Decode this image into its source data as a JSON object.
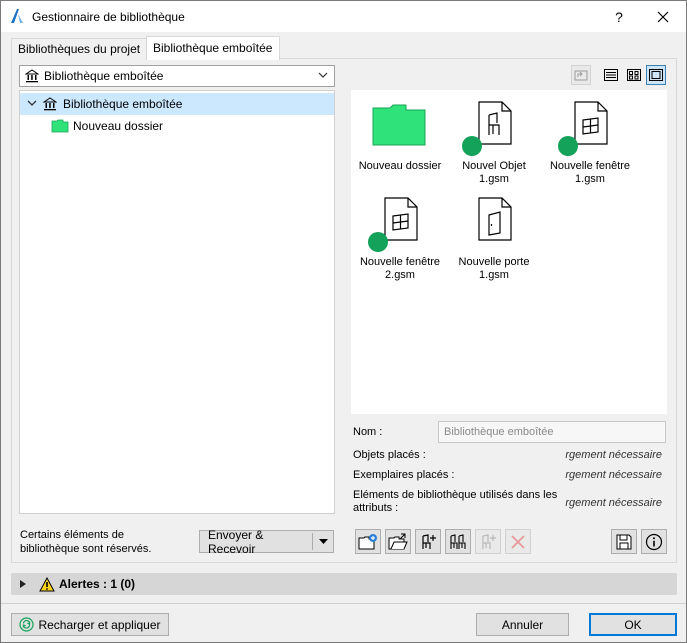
{
  "window": {
    "title": "Gestionnaire de bibliothèque",
    "help_label": "?",
    "close_label": "✕"
  },
  "tabs": [
    {
      "label": "Bibliothèques du projet"
    },
    {
      "label": "Bibliothèque emboîtée"
    }
  ],
  "library_select": {
    "value": "Bibliothèque emboîtée"
  },
  "tree": {
    "root": "Bibliothèque emboîtée",
    "children": [
      {
        "label": "Nouveau dossier"
      }
    ]
  },
  "gallery": {
    "items": [
      {
        "line1": "Nouveau dossier",
        "line2": "",
        "icon": "folder-icon"
      },
      {
        "line1": "Nouvel Objet",
        "line2": "1.gsm",
        "icon": "chair-file-icon"
      },
      {
        "line1": "Nouvelle fenêtre",
        "line2": "1.gsm",
        "icon": "window-file-icon"
      },
      {
        "line1": "Nouvelle fenêtre",
        "line2": "2.gsm",
        "icon": "window-file-icon"
      },
      {
        "line1": "Nouvelle porte",
        "line2": "1.gsm",
        "icon": "door-file-icon"
      }
    ],
    "status_dot_color": "#14a25a",
    "folder_color": "#2fe37a"
  },
  "properties": {
    "name_label": "Nom :",
    "name_value": "Bibliothèque emboîtée",
    "placed_objects_label": "Objets placés :",
    "placed_objects_value": "rgement nécessaire",
    "placed_instances_label": "Exemplaires placés :",
    "placed_instances_value": "rgement nécessaire",
    "attr_elements_label_1": "Eléments de bibliothèque utilisés dans les",
    "attr_elements_label_2": "attributs :",
    "attr_elements_value": "rgement nécessaire"
  },
  "footer": {
    "reserved_note_1": "Certains éléments de",
    "reserved_note_2": "bibliothèque sont réservés.",
    "send_receive_label": "Envoyer & Recevoir"
  },
  "alerts": {
    "label": "Alertes : 1 (0)"
  },
  "buttons": {
    "reload_label": "Recharger et appliquer",
    "cancel_label": "Annuler",
    "ok_label": "OK"
  },
  "colors": {
    "accent": "#0078d7",
    "selection": "#cce8ff"
  }
}
